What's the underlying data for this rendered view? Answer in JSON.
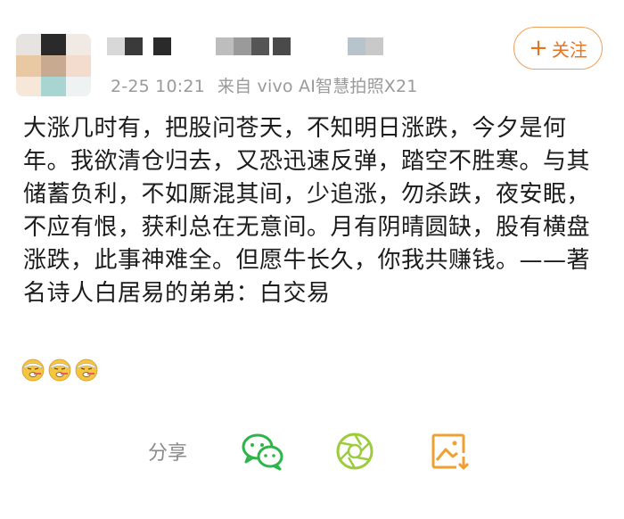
{
  "post": {
    "timestamp": "2-25 10:21",
    "source": "来自 vivo AI智慧拍照X21",
    "follow_label": "关注",
    "follow_plus": "+",
    "content": "大涨几时有，把股问苍天，不知明日涨跌，今夕是何年。我欲清仓归去，又恐迅速反弹，踏空不胜寒。与其储蓄负利，不如厮混其间，少追涨，勿杀跌，夜安眠，不应有恨，获利总在无意间。月有阴晴圆缺，股有横盘涨跌，此事神难全。但愿牛长久，你我共赚钱。——著名诗人白居易的弟弟：白交易",
    "emojis": [
      "sick-face-emoji",
      "sick-face-emoji",
      "sick-face-emoji"
    ]
  },
  "share_bar": {
    "label": "分享",
    "items": [
      {
        "name": "wechat-icon",
        "color": "#2db54a"
      },
      {
        "name": "moments-icon",
        "color": "#9ccc3c"
      },
      {
        "name": "save-image-icon",
        "color": "#f0a030"
      }
    ]
  },
  "colors": {
    "accent": "#e8731f",
    "meta_text": "#9a9a9a",
    "body_text": "#1c1c1c"
  }
}
